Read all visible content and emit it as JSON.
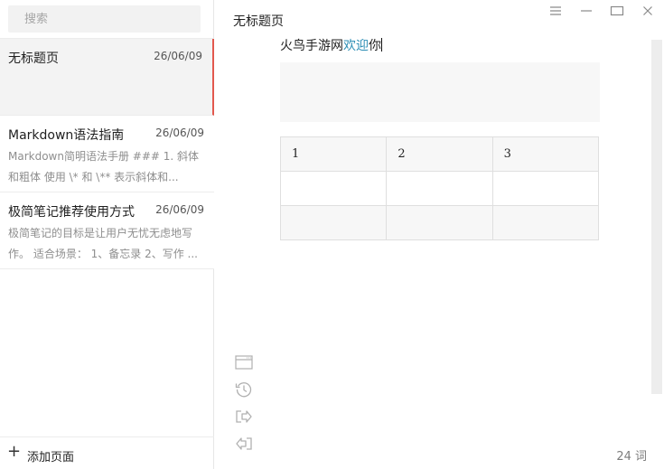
{
  "search": {
    "placeholder": "搜索"
  },
  "notes": [
    {
      "title": "无标题页",
      "date": "26/06/09",
      "preview": ""
    },
    {
      "title": "Markdown语法指南",
      "date": "26/06/09",
      "preview": "Markdown简明语法手册  ### 1. 斜体和粗体  使用 \\* 和 \\** 表示斜体和..."
    },
    {
      "title": "极简笔记推荐使用方式",
      "date": "26/06/09",
      "preview": "极简笔记的目标是让用户无忧无虑地写作。 适合场景： 1、备忘录  2、写作 ..."
    }
  ],
  "sidebar": {
    "add_label": "添加页面",
    "add_symbol": "+"
  },
  "main": {
    "title": "无标题页",
    "line_before": "火鸟手游网",
    "line_highlight": "欢迎",
    "line_after": "你",
    "table": [
      [
        "1",
        "2",
        "3"
      ],
      [
        "",
        "",
        ""
      ],
      [
        "",
        "",
        ""
      ]
    ],
    "word_count": "24 词"
  },
  "icons": {
    "menu": "menu-icon",
    "minimize": "minimize-icon",
    "maximize": "maximize-icon",
    "close": "close-icon",
    "window": "window-icon",
    "history": "history-icon",
    "export": "export-icon",
    "import": "import-icon"
  },
  "colors": {
    "active_accent": "#e2584e",
    "highlight_text": "#2f8fb5"
  }
}
